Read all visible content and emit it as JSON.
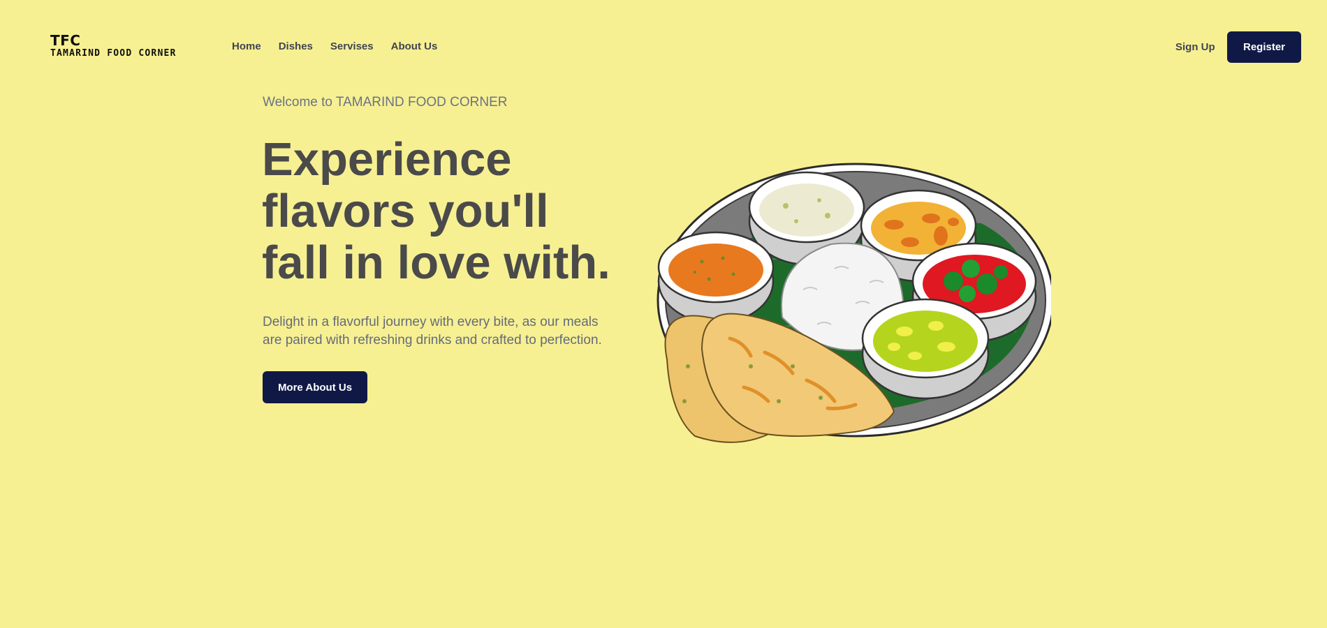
{
  "nav": {
    "logo_short": "TFC",
    "logo_full": "TAMARIND FOOD CORNER",
    "links": [
      {
        "label": "Home"
      },
      {
        "label": "Dishes"
      },
      {
        "label": "Servises"
      },
      {
        "label": "About Us"
      }
    ],
    "signup_label": "Sign Up",
    "register_label": "Register"
  },
  "hero": {
    "eyebrow": "Welcome to TAMARIND FOOD CORNER",
    "headline": "Experience flavors you'll fall in love with.",
    "description": "Delight in a flavorful journey with every bite, as our meals are paired with refreshing drinks and crafted to perfection.",
    "cta_label": "More About Us"
  },
  "colors": {
    "background": "#f7f092",
    "button": "#101946",
    "heading": "#4a4a4a",
    "body_text": "#646b7a"
  },
  "illustration": {
    "icon": "thali-plate-illustration"
  }
}
